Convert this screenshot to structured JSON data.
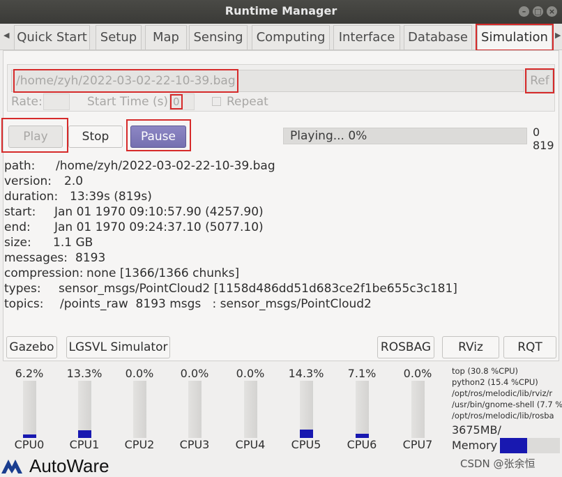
{
  "window": {
    "title": "Runtime Manager"
  },
  "tabs": [
    {
      "label": "Quick Start"
    },
    {
      "label": "Setup"
    },
    {
      "label": "Map"
    },
    {
      "label": "Sensing"
    },
    {
      "label": "Computing"
    },
    {
      "label": "Interface"
    },
    {
      "label": "Database"
    },
    {
      "label": "Simulation"
    }
  ],
  "simulation": {
    "bag_path": "/home/zyh/2022-03-02-22-10-39.bag",
    "ref_label": "Ref",
    "rate_label": "Rate:",
    "rate_value": "",
    "start_time_label": "Start Time (s):",
    "start_time_value": "0",
    "repeat_label": "Repeat",
    "play_label": "Play",
    "stop_label": "Stop",
    "pause_label": "Pause",
    "progress_text": "Playing...  0%",
    "progress_fraction": 0.0,
    "counter_current": "0",
    "counter_total": "819"
  },
  "baginfo": [
    {
      "key": "path:",
      "value": "/home/zyh/2022-03-02-22-10-39.bag"
    },
    {
      "key": "version:",
      "value": "2.0"
    },
    {
      "key": "duration:",
      "value": "13:39s (819s)"
    },
    {
      "key": "start:",
      "value": "Jan 01 1970 09:10:57.90 (4257.90)"
    },
    {
      "key": "end:",
      "value": "Jan 01 1970 09:24:37.10 (5077.10)"
    },
    {
      "key": "size:",
      "value": "1.1 GB"
    },
    {
      "key": "messages:",
      "value": "8193"
    },
    {
      "key": "compression:",
      "value": "none [1366/1366 chunks]"
    },
    {
      "key": "types:",
      "value": "sensor_msgs/PointCloud2 [1158d486dd51d683ce2f1be655c3c181]"
    },
    {
      "key": "topics:",
      "value": "/points_raw  8193 msgs   : sensor_msgs/PointCloud2"
    }
  ],
  "bottom_buttons": {
    "gazebo": "Gazebo",
    "lgsvl": "LGSVL Simulator",
    "rosbag": "ROSBAG",
    "rviz": "RViz",
    "rqt": "RQT"
  },
  "cpus": [
    {
      "name": "CPU0",
      "pct": "6.2%",
      "level": 0.062
    },
    {
      "name": "CPU1",
      "pct": "13.3%",
      "level": 0.133
    },
    {
      "name": "CPU2",
      "pct": "0.0%",
      "level": 0.0
    },
    {
      "name": "CPU3",
      "pct": "0.0%",
      "level": 0.0
    },
    {
      "name": "CPU4",
      "pct": "0.0%",
      "level": 0.0
    },
    {
      "name": "CPU5",
      "pct": "14.3%",
      "level": 0.143
    },
    {
      "name": "CPU6",
      "pct": "7.1%",
      "level": 0.071
    },
    {
      "name": "CPU7",
      "pct": "0.0%",
      "level": 0.0
    }
  ],
  "processes": [
    "top (30.8 %CPU)",
    "python2 (15.4 %CPU)",
    "/opt/ros/melodic/lib/rviz/r",
    "/usr/bin/gnome-shell (7.7 %",
    "/opt/ros/melodic/lib/rosba"
  ],
  "memory": {
    "value": "3675MB/",
    "label": "Memory",
    "level": 0.45
  },
  "logo": {
    "text": "AutoWare"
  },
  "watermark": "CSDN @张余恒",
  "colors": {
    "accent": "#7570b0",
    "cpu_bar": "#1818b0",
    "highlight": "#d62a2a"
  }
}
